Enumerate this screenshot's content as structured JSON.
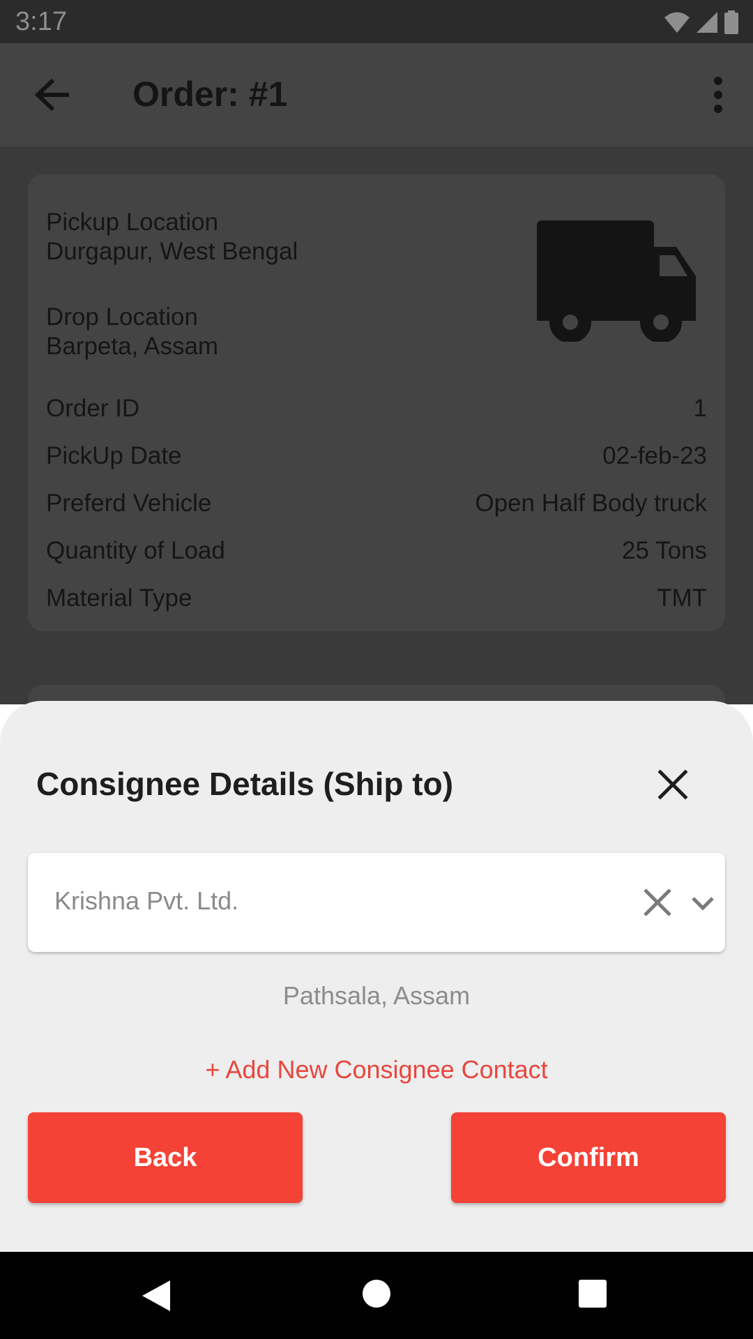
{
  "status_bar": {
    "time": "3:17"
  },
  "app_bar": {
    "title": "Order: #1"
  },
  "order_card": {
    "pickup_label": "Pickup Location",
    "pickup_value": "Durgapur, West Bengal",
    "drop_label": "Drop Location",
    "drop_value": "Barpeta, Assam",
    "rows": [
      {
        "key": "Order ID",
        "value": "1"
      },
      {
        "key": "PickUp Date",
        "value": "02-feb-23"
      },
      {
        "key": "Preferd Vehicle",
        "value": "Open Half Body truck"
      },
      {
        "key": "Quantity of Load",
        "value": "25 Tons"
      },
      {
        "key": "Material Type",
        "value": "TMT"
      }
    ]
  },
  "sheet": {
    "title": "Consignee Details (Ship to)",
    "selected_consignee": "Krishna Pvt. Ltd.",
    "address": "Pathsala, Assam",
    "add_link": "+ Add New Consignee Contact",
    "back_label": "Back",
    "confirm_label": "Confirm"
  },
  "colors": {
    "accent": "#f44236",
    "link": "#e8463d",
    "sheet_bg": "#eeeeee",
    "overlay_bg": "#3a3a3a"
  }
}
